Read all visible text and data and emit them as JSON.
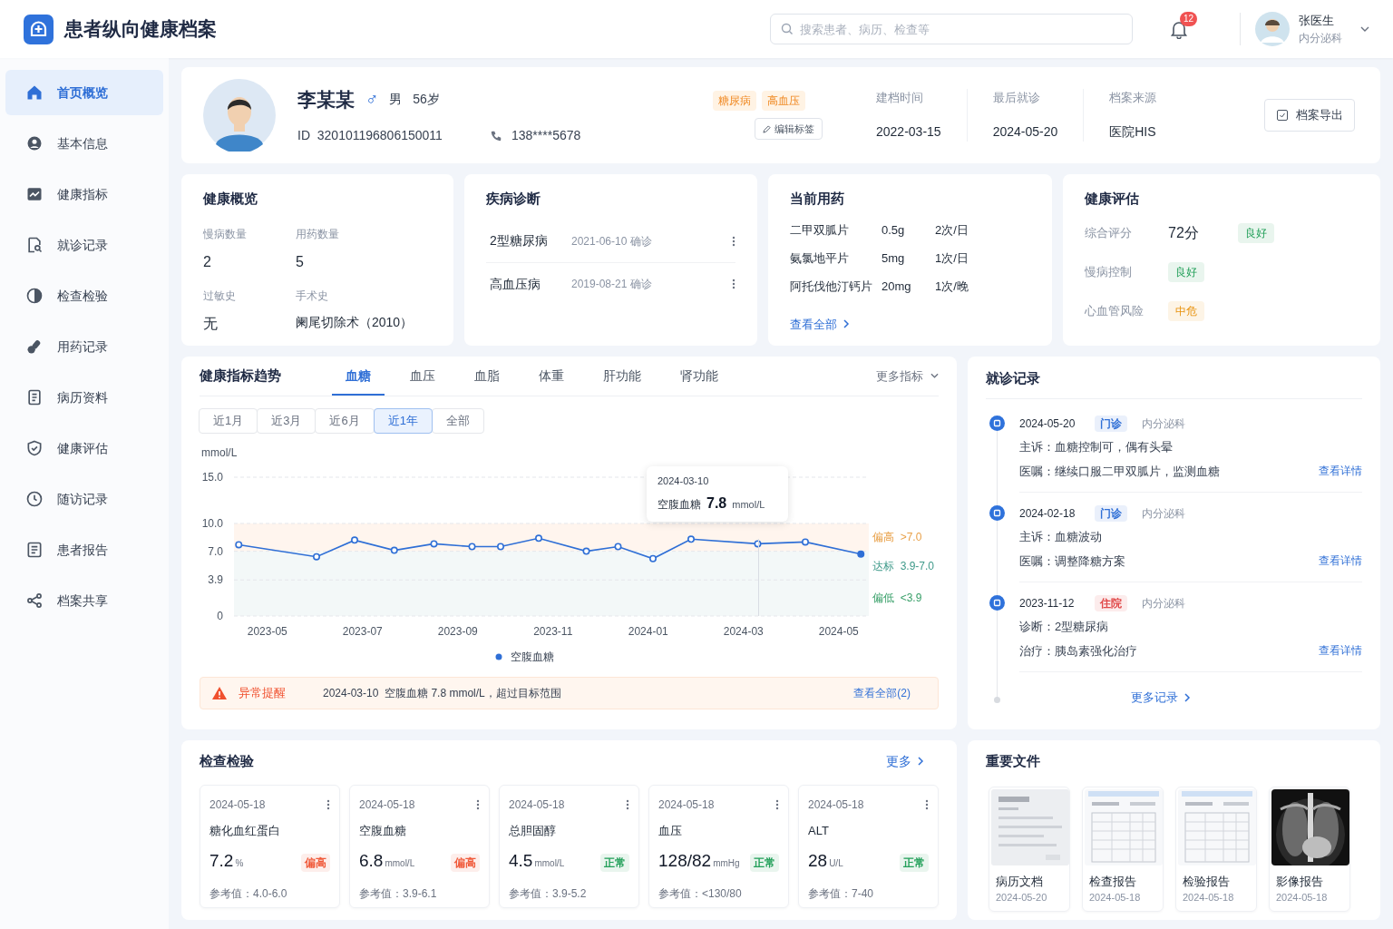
{
  "app": {
    "title": "患者纵向健康档案"
  },
  "search": {
    "placeholder": "搜索患者、病历、检查等"
  },
  "notifications": {
    "count": "12"
  },
  "user": {
    "name": "张医生",
    "dept": "内分泌科"
  },
  "sidebar": {
    "items": [
      {
        "label": "首页概览",
        "selected": true
      },
      {
        "label": "基本信息",
        "selected": false
      },
      {
        "label": "健康指标",
        "selected": false
      },
      {
        "label": "就诊记录",
        "selected": false
      },
      {
        "label": "检查检验",
        "selected": false
      },
      {
        "label": "用药记录",
        "selected": false
      },
      {
        "label": "病历资料",
        "selected": false
      },
      {
        "label": "健康评估",
        "selected": false
      },
      {
        "label": "随访记录",
        "selected": false
      },
      {
        "label": "患者报告",
        "selected": false
      },
      {
        "label": "档案共享",
        "selected": false
      }
    ]
  },
  "patient": {
    "name": "李某某",
    "gender_symbol": "♂",
    "gender": "男",
    "age": "56岁",
    "id": "ID  320101196806150011",
    "phone": "138****5678",
    "tags": [
      {
        "label": "糖尿病"
      },
      {
        "label": "高血压"
      }
    ],
    "edit_button": "编辑标签",
    "facts": [
      {
        "label": "建档时间",
        "value": "2022-03-15"
      },
      {
        "label": "最后就诊",
        "value": "2024-05-20"
      },
      {
        "label": "档案来源",
        "value": "医院HIS"
      }
    ],
    "export_button": "档案导出"
  },
  "health_overview": {
    "title": "健康概览",
    "items": [
      {
        "label": "慢病数量",
        "value": "2"
      },
      {
        "label": "用药数量",
        "value": "5"
      },
      {
        "label": "过敏史",
        "value": "无"
      },
      {
        "label": "手术史",
        "value": "阑尾切除术（2010）"
      }
    ]
  },
  "diagnoses": {
    "title": "疾病诊断",
    "items": [
      {
        "name": "2型糖尿病",
        "date": "2021-06-10 确诊"
      },
      {
        "name": "高血压病",
        "date": "2019-08-21 确诊"
      }
    ]
  },
  "medications": {
    "title": "当前用药",
    "items": [
      {
        "name": "二甲双胍片",
        "dose": "0.5g",
        "frequency": "2次/日"
      },
      {
        "name": "氨氯地平片",
        "dose": "5mg",
        "frequency": "1次/日"
      },
      {
        "name": "阿托伐他汀钙片",
        "dose": "20mg",
        "frequency": "1次/晚"
      }
    ],
    "link": "查看全部"
  },
  "assessment": {
    "title": "健康评估",
    "items": [
      {
        "label": "综合评分",
        "score": "72分",
        "status": "良好",
        "color": "#23a05a"
      },
      {
        "label": "慢病控制",
        "status": "良好",
        "color": "#23a05a"
      },
      {
        "label": "心血管风险",
        "status": "中危",
        "color": "#e8920c"
      }
    ]
  },
  "trends": {
    "title": "健康指标趋势",
    "tabs": [
      {
        "label": "血糖",
        "selected": true
      },
      {
        "label": "血压",
        "selected": false
      },
      {
        "label": "血脂",
        "selected": false
      },
      {
        "label": "体重",
        "selected": false
      },
      {
        "label": "肝功能",
        "selected": false
      },
      {
        "label": "肾功能",
        "selected": false
      }
    ],
    "more": "更多指标",
    "ranges": [
      {
        "label": "近1月",
        "selected": false
      },
      {
        "label": "近3月",
        "selected": false
      },
      {
        "label": "近6月",
        "selected": false
      },
      {
        "label": "近1年",
        "selected": true
      },
      {
        "label": "全部",
        "selected": false
      }
    ],
    "chart_data": {
      "type": "line",
      "ylabel": "mmol/L",
      "x": [
        "2023-04-13",
        "2023-06-02",
        "2023-06-26",
        "2023-07-21",
        "2023-08-16",
        "2023-09-10",
        "2023-09-28",
        "2023-10-22",
        "2023-11-22",
        "2023-12-12",
        "2024-01-04",
        "2024-01-28",
        "2024-03-10",
        "2024-04-10",
        "2024-05-15"
      ],
      "grid": true,
      "bands": [
        {
          "axis": "y",
          "from": 7,
          "to": 10
        },
        {
          "axis": "y",
          "from": 0,
          "to": 7
        }
      ],
      "series": [
        {
          "name": "空腹血糖",
          "color": "#2f6fd6",
          "marker": "circle",
          "values": [
            7.7,
            6.4,
            8.2,
            7.1,
            7.8,
            7.5,
            7.5,
            8.4,
            7.0,
            7.5,
            6.2,
            8.3,
            7.8,
            8.0,
            6.7
          ]
        }
      ],
      "xlim": [
        "2023-04-10",
        "2024-05-20"
      ],
      "ylim": [
        0,
        15
      ],
      "yticks": [
        0,
        3.9,
        {
          "value": 7,
          "label": "7.0"
        },
        {
          "value": 10,
          "label": "10.0"
        },
        {
          "value": 15,
          "label": "15.0"
        }
      ],
      "xticks": [
        {
          "value": "2023-05-01",
          "label": "2023-05"
        },
        {
          "value": "2023-07-01",
          "label": "2023-07"
        },
        {
          "value": "2023-09-01",
          "label": "2023-09"
        },
        {
          "value": "2023-11-01",
          "label": "2023-11"
        },
        {
          "value": "2024-01-01",
          "label": "2024-01"
        },
        {
          "value": "2024-03-01",
          "label": "2024-03"
        },
        {
          "value": "2024-05-01",
          "label": "2024-05"
        }
      ],
      "annotations": [
        {
          "text": "偏高  >7.0"
        },
        {
          "text": "达标  3.9-7.0"
        },
        {
          "text": "偏低  <3.9"
        }
      ]
    },
    "tooltip": {
      "date": "2024-03-10",
      "label": "空腹血糖",
      "value": "7.8",
      "unit": "mmol/L"
    },
    "alert": {
      "title": "异常提醒",
      "text": "2024-03-10  空腹血糖 7.8 mmol/L，超过目标范围",
      "link": "查看全部(2)"
    }
  },
  "visits": {
    "title": "就诊记录",
    "items": [
      {
        "date": "2024-05-20",
        "type": "门诊",
        "color": "#2f6fd6",
        "dept": "内分泌科",
        "lines": [
          {
            "label": "主诉：",
            "text": "血糖控制可，偶有头晕"
          },
          {
            "label": "医嘱：",
            "text": "继续口服二甲双胍片，监测血糖"
          }
        ],
        "link": "查看详情"
      },
      {
        "date": "2024-02-18",
        "type": "门诊",
        "color": "#2f6fd6",
        "dept": "内分泌科",
        "lines": [
          {
            "label": "主诉：",
            "text": "血糖波动"
          },
          {
            "label": "医嘱：",
            "text": "调整降糖方案"
          }
        ],
        "link": "查看详情"
      },
      {
        "date": "2023-11-12",
        "type": "住院",
        "color": "#e04848",
        "dept": "内分泌科",
        "lines": [
          {
            "label": "诊断：",
            "text": "2型糖尿病"
          },
          {
            "label": "治疗：",
            "text": "胰岛素强化治疗"
          }
        ],
        "link": "查看详情"
      }
    ],
    "more": "更多记录"
  },
  "labs": {
    "title": "检查检验",
    "more": "更多",
    "items": [
      {
        "date": "2024-05-18",
        "name": "糖化血红蛋白",
        "value": "7.2",
        "unit": "%",
        "status": "偏高",
        "color": "#f05a3a",
        "reference": "参考值：4.0-6.0"
      },
      {
        "date": "2024-05-18",
        "name": "空腹血糖",
        "value": "6.8",
        "unit": "mmol/L",
        "status": "偏高",
        "color": "#f05a3a",
        "reference": "参考值：3.9-6.1"
      },
      {
        "date": "2024-05-18",
        "name": "总胆固醇",
        "value": "4.5",
        "unit": "mmol/L",
        "status": "正常",
        "color": "#23a05a",
        "reference": "参考值：3.9-5.2"
      },
      {
        "date": "2024-05-18",
        "name": "血压",
        "value": "128/82",
        "unit": "mmHg",
        "status": "正常",
        "color": "#23a05a",
        "reference": "参考值：<130/80"
      },
      {
        "date": "2024-05-18",
        "name": "ALT",
        "value": "28",
        "unit": "U/L",
        "status": "正常",
        "color": "#23a05a",
        "reference": "参考值：7-40"
      }
    ]
  },
  "documents": {
    "title": "重要文件",
    "items": [
      {
        "name": "病历文档",
        "date": "2024-05-20",
        "kind": "document"
      },
      {
        "name": "检查报告",
        "date": "2024-05-18",
        "kind": "table"
      },
      {
        "name": "检验报告",
        "date": "2024-05-18",
        "kind": "table"
      },
      {
        "name": "影像报告",
        "date": "2024-05-18",
        "kind": "xray"
      }
    ]
  }
}
